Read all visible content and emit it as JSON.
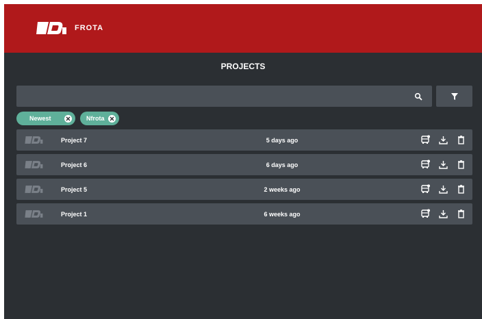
{
  "brand": {
    "name": "FROTA",
    "accent": "#b0191b"
  },
  "page": {
    "title": "PROJECTS"
  },
  "search": {
    "placeholder": "",
    "value": ""
  },
  "filters": [
    {
      "label": "Newest"
    },
    {
      "label": "Nfrota"
    }
  ],
  "projects": [
    {
      "name": "Project 7",
      "modified": "5 days ago"
    },
    {
      "name": "Project 6",
      "modified": "6 days ago"
    },
    {
      "name": "Project 5",
      "modified": "2 weeks ago"
    },
    {
      "name": "Project 1",
      "modified": "6 weeks ago"
    }
  ],
  "colors": {
    "background": "#2b2f33",
    "surface": "#4a5057",
    "chip": "#5fb09a"
  },
  "icons": [
    "logo-icon",
    "search-icon",
    "filter-icon",
    "close-icon",
    "bus-icon",
    "download-icon",
    "trash-icon"
  ]
}
